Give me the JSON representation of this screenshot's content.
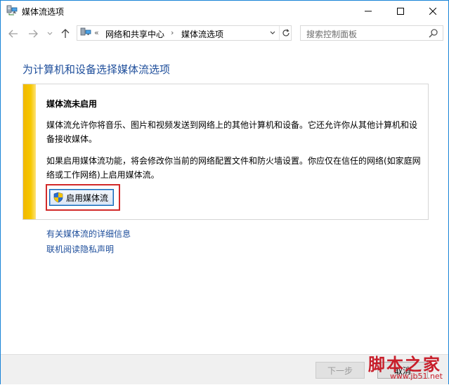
{
  "window": {
    "title": "媒体流选项"
  },
  "nav": {
    "back_icon": "back-arrow-icon",
    "forward_icon": "forward-arrow-icon",
    "up_icon": "up-arrow-icon",
    "breadcrumb_overflow": "«",
    "breadcrumb": [
      "网络和共享中心",
      "媒体流选项"
    ],
    "search_placeholder": "搜索控制面板"
  },
  "content": {
    "page_title": "为计算机和设备选择媒体流选项",
    "panel": {
      "heading": "媒体流未启用",
      "paragraph1": "媒体流允许你将音乐、图片和视频发送到网络上的其他计算机和设备。它还允许你从其他计算机和设备接收媒体。",
      "paragraph2": "如果启用媒体流功能，将会修改你当前的网络配置文件和防火墙设置。你应仅在信任的网络(如家庭网络或工作网络)上启用媒体流。",
      "enable_button": "启用媒体流"
    },
    "links": [
      "有关媒体流的详细信息",
      "联机阅读隐私声明"
    ]
  },
  "footer": {
    "next_button": "下一步",
    "cancel_button": "取消"
  },
  "watermark": {
    "logo": "脚本之家",
    "url": "www.jb51.net"
  },
  "colors": {
    "accent_border": "#1883d7",
    "title_blue": "#1e4e9b",
    "panel_bar": "#f1b700",
    "highlight_red": "#d22a2a"
  }
}
